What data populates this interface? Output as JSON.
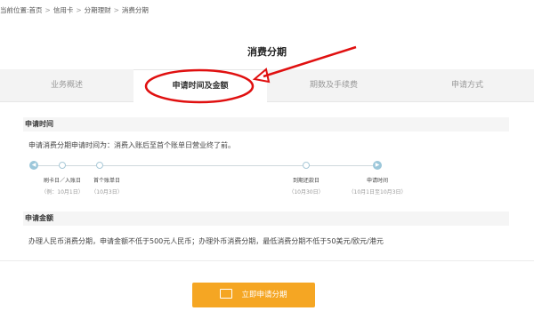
{
  "breadcrumb": {
    "prefix": "当前位置:",
    "items": [
      "首页",
      "信用卡",
      "分期理财",
      "消费分期"
    ],
    "separator": ">"
  },
  "page_title": "消费分期",
  "tabs": [
    {
      "label": "业务概述",
      "active": false
    },
    {
      "label": "申请时间及金额",
      "active": true
    },
    {
      "label": "期数及手续费",
      "active": false
    },
    {
      "label": "申请方式",
      "active": false
    }
  ],
  "section_time": {
    "heading": "申请时间",
    "note": "申请消费分期申请时间为：消费入账后至首个账单日营业终了前。",
    "timeline": [
      {
        "label": "刷卡日／入账日",
        "sub": "（例：10月1日）"
      },
      {
        "label": "首个账单日",
        "sub": "（10月3日）"
      },
      {
        "label": "到期还款日",
        "sub": "（10月30日）"
      },
      {
        "label": "申请时间",
        "sub": "（10月1日至10月3日）"
      }
    ]
  },
  "section_amount": {
    "heading": "申请金额",
    "note": "办理人民币消费分期，申请金额不低于500元人民币；办理外币消费分期，最低消费分期不低于50美元/欧元/港元"
  },
  "apply_button": {
    "label": "立即申请分期"
  },
  "colors": {
    "accent_orange": "#f5a623",
    "annotation_red": "#e01010",
    "timeline_blue": "#9cc7da"
  }
}
